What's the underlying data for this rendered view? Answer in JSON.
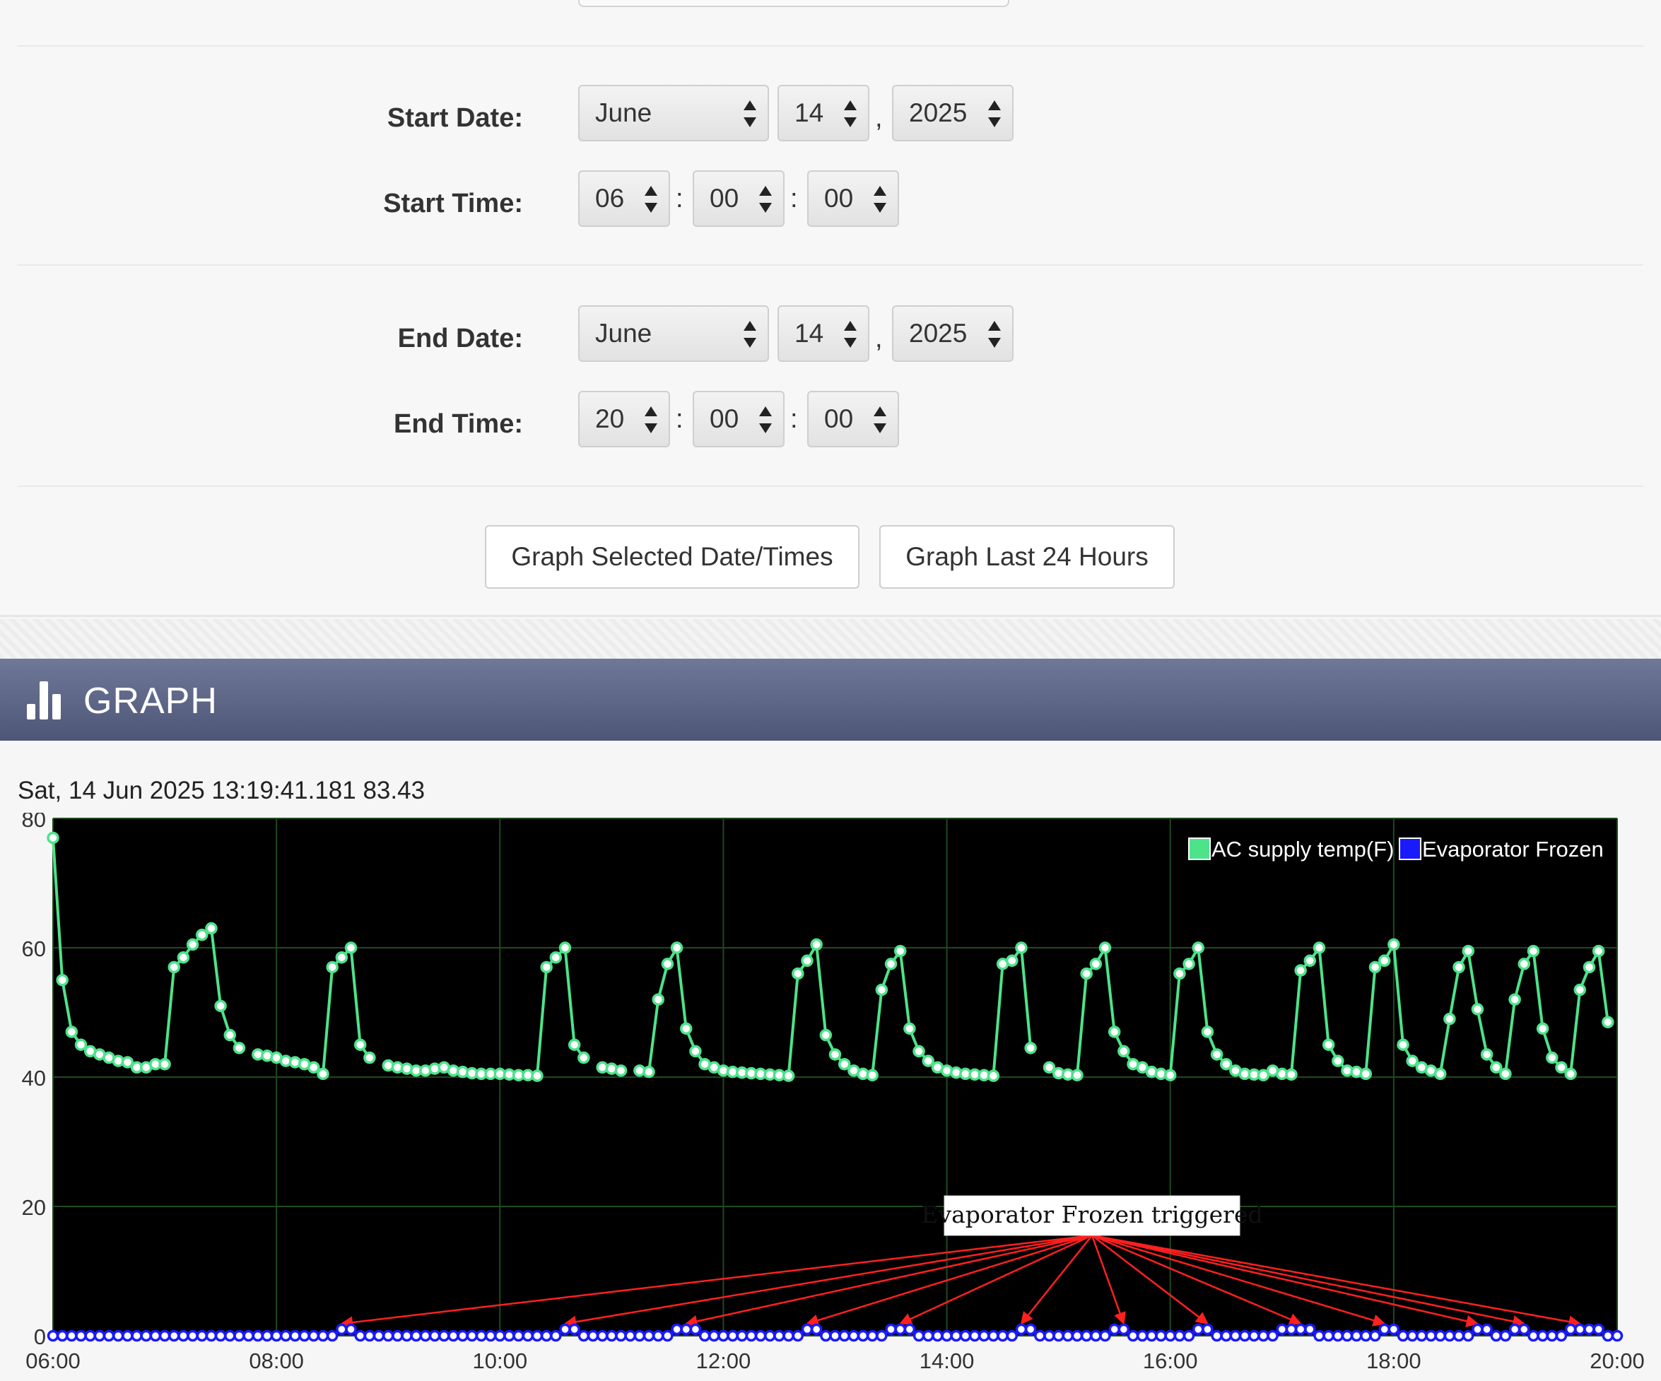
{
  "start": {
    "date_label": "Start Date:",
    "time_label": "Start Time:",
    "month": "June",
    "day": "14",
    "year": "2025",
    "hour": "06",
    "minute": "00",
    "second": "00"
  },
  "end": {
    "date_label": "End Date:",
    "time_label": "End Time:",
    "month": "June",
    "day": "14",
    "year": "2025",
    "hour": "20",
    "minute": "00",
    "second": "00"
  },
  "separators": {
    "date": ",",
    "time": ":"
  },
  "buttons": {
    "graph_selected": "Graph Selected Date/Times",
    "graph_last_24": "Graph Last 24 Hours"
  },
  "graph": {
    "title": "GRAPH",
    "icon": "bar-chart-icon",
    "readout": "Sat, 14 Jun 2025 13:19:41.181 83.43"
  },
  "colors": {
    "header_bar": "#5f6787",
    "plot_bg": "#000000",
    "grid": "#1f4a1f",
    "ac_supply": "#4de38a",
    "evaporator": "#1a1aff",
    "annotation_arrow": "#ff2020"
  },
  "chart_data": {
    "type": "line",
    "xlabel": "",
    "ylabel": "",
    "x_ticks": [
      "06:00",
      "08:00",
      "10:00",
      "12:00",
      "14:00",
      "16:00",
      "18:00",
      "20:00"
    ],
    "xlim": [
      "06:00",
      "20:00"
    ],
    "ylim": [
      0,
      80
    ],
    "y_ticks": [
      0,
      20,
      40,
      60,
      80
    ],
    "grid": true,
    "legend_position": "top-right",
    "series": [
      {
        "name": "AC supply temp(F)",
        "color": "#4de38a",
        "points": [
          [
            "06:00",
            77
          ],
          [
            "06:05",
            55
          ],
          [
            "06:10",
            47
          ],
          [
            "06:15",
            45
          ],
          [
            "06:20",
            44
          ],
          [
            "06:25",
            43.5
          ],
          [
            "06:30",
            43
          ],
          [
            "06:35",
            42.5
          ],
          [
            "06:40",
            42.3
          ],
          [
            "06:45",
            41.5
          ],
          [
            "06:50",
            41.5
          ],
          [
            "06:55",
            42
          ],
          [
            "07:00",
            42
          ],
          [
            "07:05",
            57
          ],
          [
            "07:10",
            58.5
          ],
          [
            "07:15",
            60.5
          ],
          [
            "07:20",
            62
          ],
          [
            "07:25",
            63
          ],
          [
            "07:30",
            51
          ],
          [
            "07:35",
            46.5
          ],
          [
            "07:40",
            44.5
          ],
          [
            "07:50",
            43.5
          ],
          [
            "07:55",
            43.3
          ],
          [
            "08:00",
            43
          ],
          [
            "08:05",
            42.5
          ],
          [
            "08:10",
            42.3
          ],
          [
            "08:15",
            42
          ],
          [
            "08:20",
            41.5
          ],
          [
            "08:25",
            40.5
          ],
          [
            "08:30",
            57
          ],
          [
            "08:35",
            58.5
          ],
          [
            "08:40",
            60
          ],
          [
            "08:45",
            45
          ],
          [
            "08:50",
            43
          ],
          [
            "09:00",
            41.8
          ],
          [
            "09:05",
            41.5
          ],
          [
            "09:10",
            41.3
          ],
          [
            "09:15",
            41
          ],
          [
            "09:20",
            41
          ],
          [
            "09:25",
            41.3
          ],
          [
            "09:30",
            41.5
          ],
          [
            "09:35",
            41
          ],
          [
            "09:40",
            40.8
          ],
          [
            "09:45",
            40.6
          ],
          [
            "09:50",
            40.5
          ],
          [
            "09:55",
            40.5
          ],
          [
            "10:00",
            40.5
          ],
          [
            "10:05",
            40.4
          ],
          [
            "10:10",
            40.3
          ],
          [
            "10:15",
            40.3
          ],
          [
            "10:20",
            40.2
          ],
          [
            "10:25",
            57
          ],
          [
            "10:30",
            58.5
          ],
          [
            "10:35",
            60
          ],
          [
            "10:40",
            45
          ],
          [
            "10:45",
            43
          ],
          [
            "10:55",
            41.5
          ],
          [
            "11:00",
            41.3
          ],
          [
            "11:05",
            41
          ],
          [
            "11:15",
            41
          ],
          [
            "11:20",
            40.8
          ],
          [
            "11:25",
            52
          ],
          [
            "11:30",
            57.5
          ],
          [
            "11:35",
            60
          ],
          [
            "11:40",
            47.5
          ],
          [
            "11:45",
            44
          ],
          [
            "11:50",
            42
          ],
          [
            "11:55",
            41.5
          ],
          [
            "12:00",
            41
          ],
          [
            "12:05",
            40.8
          ],
          [
            "12:10",
            40.7
          ],
          [
            "12:15",
            40.6
          ],
          [
            "12:20",
            40.5
          ],
          [
            "12:25",
            40.4
          ],
          [
            "12:30",
            40.3
          ],
          [
            "12:35",
            40.2
          ],
          [
            "12:40",
            56
          ],
          [
            "12:45",
            58
          ],
          [
            "12:50",
            60.5
          ],
          [
            "12:55",
            46.5
          ],
          [
            "13:00",
            43.5
          ],
          [
            "13:05",
            42
          ],
          [
            "13:10",
            41
          ],
          [
            "13:15",
            40.5
          ],
          [
            "13:20",
            40.3
          ],
          [
            "13:25",
            53.5
          ],
          [
            "13:30",
            57.5
          ],
          [
            "13:35",
            59.5
          ],
          [
            "13:40",
            47.5
          ],
          [
            "13:45",
            44
          ],
          [
            "13:50",
            42.5
          ],
          [
            "13:55",
            41.5
          ],
          [
            "14:00",
            41
          ],
          [
            "14:05",
            40.7
          ],
          [
            "14:10",
            40.5
          ],
          [
            "14:15",
            40.4
          ],
          [
            "14:20",
            40.3
          ],
          [
            "14:25",
            40.2
          ],
          [
            "14:30",
            57.5
          ],
          [
            "14:35",
            58
          ],
          [
            "14:40",
            60
          ],
          [
            "14:45",
            44.5
          ],
          [
            "14:55",
            41.5
          ],
          [
            "15:00",
            40.6
          ],
          [
            "15:05",
            40.4
          ],
          [
            "15:10",
            40.3
          ],
          [
            "15:15",
            56
          ],
          [
            "15:20",
            57.5
          ],
          [
            "15:25",
            60
          ],
          [
            "15:30",
            47
          ],
          [
            "15:35",
            44
          ],
          [
            "15:40",
            42
          ],
          [
            "15:45",
            41.5
          ],
          [
            "15:50",
            40.8
          ],
          [
            "15:55",
            40.5
          ],
          [
            "16:00",
            40.3
          ],
          [
            "16:05",
            56
          ],
          [
            "16:10",
            57.5
          ],
          [
            "16:15",
            60
          ],
          [
            "16:20",
            47
          ],
          [
            "16:25",
            43.5
          ],
          [
            "16:30",
            42
          ],
          [
            "16:35",
            41
          ],
          [
            "16:40",
            40.5
          ],
          [
            "16:45",
            40.4
          ],
          [
            "16:50",
            40.3
          ],
          [
            "16:55",
            41
          ],
          [
            "17:00",
            40.5
          ],
          [
            "17:05",
            40.4
          ],
          [
            "17:10",
            56.5
          ],
          [
            "17:15",
            58
          ],
          [
            "17:20",
            60
          ],
          [
            "17:25",
            45
          ],
          [
            "17:30",
            42.5
          ],
          [
            "17:35",
            41
          ],
          [
            "17:40",
            40.8
          ],
          [
            "17:45",
            40.5
          ],
          [
            "17:50",
            57
          ],
          [
            "17:55",
            58
          ],
          [
            "18:00",
            60.5
          ],
          [
            "18:05",
            45
          ],
          [
            "18:10",
            42.5
          ],
          [
            "18:15",
            41.5
          ],
          [
            "18:20",
            41
          ],
          [
            "18:25",
            40.5
          ],
          [
            "18:30",
            49
          ],
          [
            "18:35",
            57
          ],
          [
            "18:40",
            59.5
          ],
          [
            "18:45",
            50.5
          ],
          [
            "18:50",
            43.5
          ],
          [
            "18:55",
            41.5
          ],
          [
            "19:00",
            40.5
          ],
          [
            "19:05",
            52
          ],
          [
            "19:10",
            57.5
          ],
          [
            "19:15",
            59.5
          ],
          [
            "19:20",
            47.5
          ],
          [
            "19:25",
            43
          ],
          [
            "19:30",
            41.5
          ],
          [
            "19:35",
            40.5
          ],
          [
            "19:40",
            53.5
          ],
          [
            "19:45",
            57
          ],
          [
            "19:50",
            59.5
          ],
          [
            "19:55",
            48.5
          ]
        ]
      },
      {
        "name": "Evaporator Frozen",
        "color": "#1a1aff",
        "baseline": 0,
        "flag_value": 1,
        "flagged_times": [
          "08:35",
          "08:40",
          "10:35",
          "10:40",
          "11:35",
          "11:40",
          "11:45",
          "12:45",
          "12:50",
          "13:30",
          "13:35",
          "13:40",
          "14:40",
          "14:45",
          "15:30",
          "15:35",
          "16:15",
          "16:20",
          "17:00",
          "17:05",
          "17:10",
          "17:15",
          "17:55",
          "18:00",
          "18:45",
          "18:50",
          "19:05",
          "19:10",
          "19:35",
          "19:40",
          "19:45",
          "19:50"
        ]
      }
    ],
    "annotations": [
      {
        "text": "Evaporator Frozen triggered",
        "arrow_targets": [
          "08:35",
          "10:35",
          "11:40",
          "12:45",
          "13:35",
          "14:40",
          "15:35",
          "16:20",
          "17:10",
          "17:55",
          "18:45",
          "19:10",
          "19:40"
        ]
      }
    ]
  }
}
